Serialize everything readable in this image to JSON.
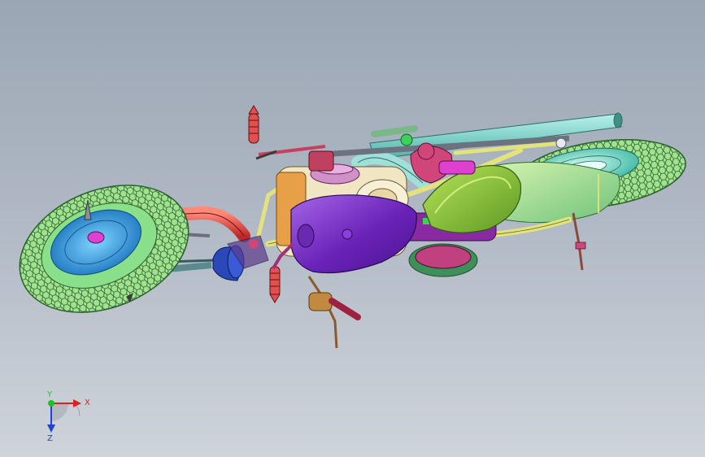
{
  "viewport": {
    "model": "motorcycle-assembly",
    "colors": {
      "background_top": "#9ba6b5",
      "background_bottom": "#cfd4db",
      "tire": "#9ee38f",
      "tire_line": "#2b5a2b",
      "front_hub": "#3aa7e6",
      "rear_hub": "#7fe0cf",
      "fuel_tank": "#7a2bc4",
      "seat": "#78b82c",
      "frame": "#e0e07a",
      "exhaust": "#7fd8d0",
      "fork_red": "#e0443a",
      "engine_pink": "#d0457a",
      "headlamp": "#2440a8"
    }
  },
  "triad": {
    "x_label": "X",
    "y_label": "Y",
    "z_label": "Z",
    "x_color": "#e02020",
    "y_color": "#20c020",
    "z_color": "#2040e0"
  }
}
